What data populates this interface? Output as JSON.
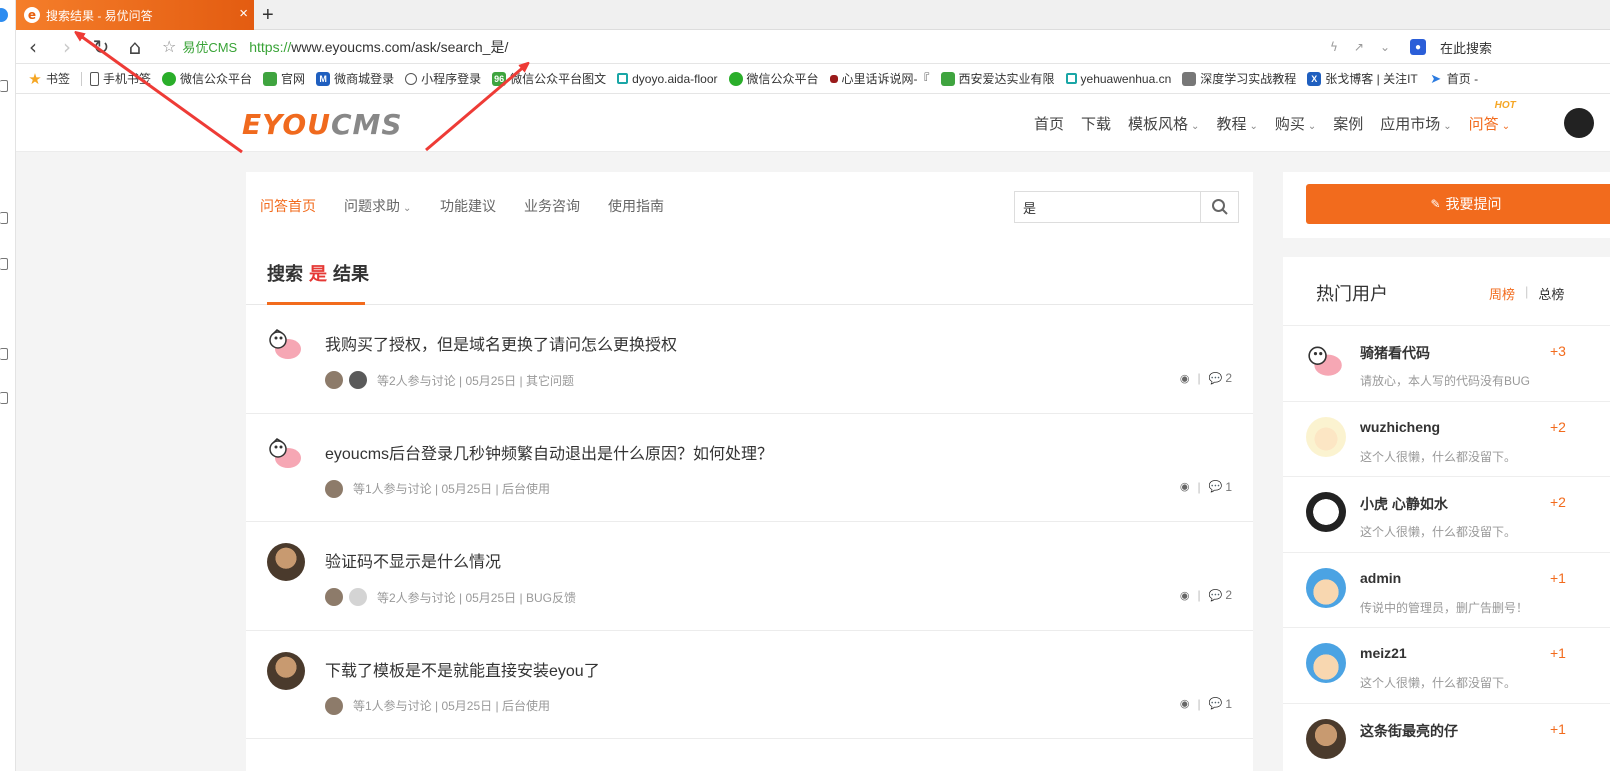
{
  "browser": {
    "tab": {
      "title": "搜索结果 - 易优问答",
      "close": "×",
      "favicon": "e"
    },
    "new_tab": "+",
    "address": {
      "site_name": "易优CMS",
      "url_scheme": "https://",
      "url_rest": "www.eyoucms.com/ask/search_是/",
      "search_engine_label": "在此搜索"
    },
    "bookmarks": [
      {
        "label": "书签",
        "icon": "star"
      },
      {
        "label": "手机书签",
        "icon": "phone"
      },
      {
        "label": "微信公众平台",
        "icon": "wx"
      },
      {
        "label": "官网",
        "icon": "green"
      },
      {
        "label": "微商城登录",
        "icon": "blue"
      },
      {
        "label": "小程序登录",
        "icon": "globe"
      },
      {
        "label": "微信公众平台图文",
        "icon": "green"
      },
      {
        "label": "dyoyo.aida-floor",
        "icon": "teal"
      },
      {
        "label": "微信公众平台",
        "icon": "wx"
      },
      {
        "label": "心里话诉说网-『",
        "icon": "red"
      },
      {
        "label": "西安爱达实业有限",
        "icon": "green"
      },
      {
        "label": "yehuawenhua.cn",
        "icon": "teal"
      },
      {
        "label": "深度学习实战教程",
        "icon": "gray"
      },
      {
        "label": "张戈博客 | 关注IT",
        "icon": "blue"
      },
      {
        "label": "首页 -",
        "icon": "rocket"
      }
    ]
  },
  "site": {
    "logo_a": "EYOU",
    "logo_b": "CMS",
    "nav": [
      {
        "label": "首页",
        "caret": false
      },
      {
        "label": "下载",
        "caret": false
      },
      {
        "label": "模板风格",
        "caret": true
      },
      {
        "label": "教程",
        "caret": true
      },
      {
        "label": "购买",
        "caret": true
      },
      {
        "label": "案例",
        "caret": false
      },
      {
        "label": "应用市场",
        "caret": true
      },
      {
        "label": "问答",
        "caret": true,
        "active": true,
        "badge": "HOT"
      }
    ]
  },
  "subnav": [
    "问答首页",
    "问题求助",
    "功能建议",
    "业务咨询",
    "使用指南"
  ],
  "search": {
    "value": "是"
  },
  "results": {
    "prefix": "搜索",
    "keyword": "是",
    "suffix": "结果"
  },
  "questions": [
    {
      "title": "我购买了授权，但是域名更换了请问怎么更换授权",
      "participants": 2,
      "meta": "等2人参与讨论 | 05月25日 | 其它问题",
      "views": "",
      "comments": "2",
      "avatar": "pig"
    },
    {
      "title": "eyoucms后台登录几秒钟频繁自动退出是什么原因？如何处理？",
      "participants": 1,
      "meta": "等1人参与讨论 | 05月25日 | 后台使用",
      "views": "",
      "comments": "1",
      "avatar": "pig"
    },
    {
      "title": "验证码不显示是什么情况",
      "participants": 2,
      "meta": "等2人参与讨论 | 05月25日 | BUG反馈",
      "views": "",
      "comments": "2",
      "avatar": "photo"
    },
    {
      "title": "下载了模板是不是就能直接安装eyou了",
      "participants": 1,
      "meta": "等1人参与讨论 | 05月25日 | 后台使用",
      "views": "",
      "comments": "1",
      "avatar": "photo"
    }
  ],
  "ask_button": "我要提问",
  "hot_users": {
    "title": "热门用户",
    "tab_week": "周榜",
    "tab_total": "总榜",
    "users": [
      {
        "name": "骑猪看代码",
        "desc": "请放心，本人写的代码没有BUG",
        "score": "+3",
        "avatar": "pig"
      },
      {
        "name": "wuzhicheng",
        "desc": "这个人很懒，什么都没留下。",
        "score": "+2",
        "avatar": "girl"
      },
      {
        "name": "小虎 心静如水",
        "desc": "这个人很懒，什么都没留下。",
        "score": "+2",
        "avatar": "sketch"
      },
      {
        "name": "admin",
        "desc": "传说中的管理员，删广告删号！",
        "score": "+1",
        "avatar": "boy"
      },
      {
        "name": "meiz21",
        "desc": "这个人很懒，什么都没留下。",
        "score": "+1",
        "avatar": "boy"
      },
      {
        "name": "这条街最亮的仔",
        "desc": "",
        "score": "+1",
        "avatar": "photo"
      }
    ]
  },
  "colors": {
    "accent": "#f26b1d",
    "keyword": "#e53935",
    "arrow": "#ee3b36"
  }
}
